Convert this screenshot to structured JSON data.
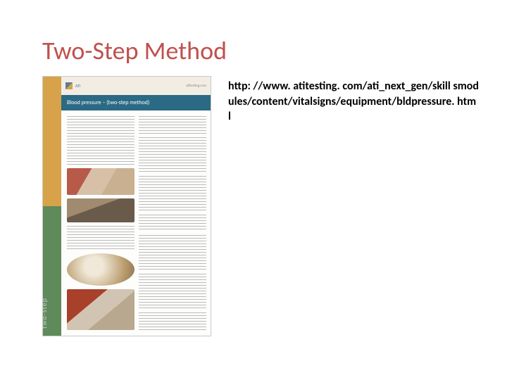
{
  "title": "Two-Step Method",
  "url": "http: //www. atitesting. com/ati_next_gen/skill smodules/content/vitalsigns/equipment/bldpressure. html",
  "thumbnail": {
    "brand": "ATI",
    "site": "atitesting.com",
    "doc_title": "Blood pressure – (two-step method)",
    "side_label": "two-step"
  }
}
